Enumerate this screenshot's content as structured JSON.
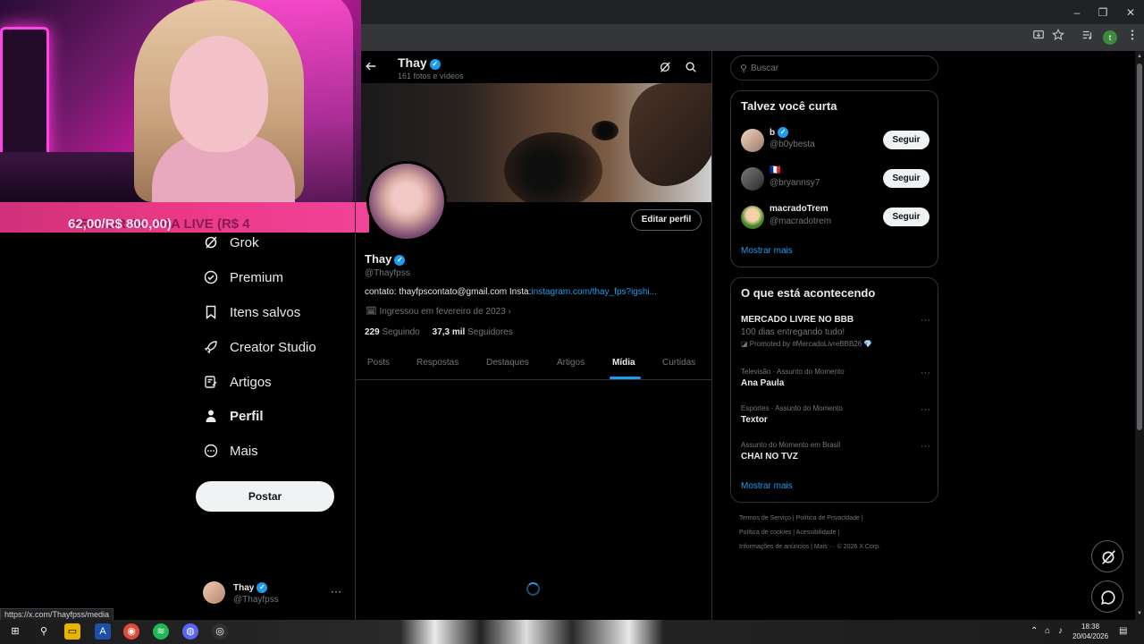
{
  "stream_overlay": {
    "banner_text_dim": "MELHORIAS PRA LIVE (R$ 4",
    "banner_text_bright": "62,00/R$ 800,00)"
  },
  "window_controls": [
    "–",
    "❐",
    "✕"
  ],
  "nav": {
    "items": [
      {
        "label": "Grok",
        "icon": "grok-icon"
      },
      {
        "label": "Premium",
        "icon": "premium-icon"
      },
      {
        "label": "Itens salvos",
        "icon": "bookmark-icon"
      },
      {
        "label": "Creator Studio",
        "icon": "rocket-icon"
      },
      {
        "label": "Artigos",
        "icon": "article-icon"
      },
      {
        "label": "Perfil",
        "icon": "person-icon",
        "active": true
      },
      {
        "label": "Mais",
        "icon": "more-circle-icon"
      }
    ],
    "post_button": "Postar"
  },
  "account": {
    "name": "Thay",
    "handle": "@Thayfpss",
    "more": "···"
  },
  "status_url": "https://x.com/Thayfpss/media",
  "profile_header": {
    "name": "Thay",
    "subtitle": "161 fotos e vídeos"
  },
  "profile": {
    "edit_button": "Editar perfil",
    "name": "Thay",
    "handle": "@Thayfpss",
    "bio_text": "contato: thayfpscontato@gmail.com Insta:",
    "bio_link": "instagram.com/thay_fps?igshi...",
    "joined": "Ingressou em fevereiro de 2023",
    "following_count": "229",
    "following_label": "Seguindo",
    "followers_count": "37,3 mil",
    "followers_label": "Seguidores"
  },
  "tabs": [
    {
      "label": "Posts"
    },
    {
      "label": "Respostas"
    },
    {
      "label": "Destaques"
    },
    {
      "label": "Artigos"
    },
    {
      "label": "Mídia",
      "active": true
    },
    {
      "label": "Curtidas"
    }
  ],
  "search": {
    "placeholder": "Buscar"
  },
  "suggestions": {
    "title": "Talvez você curta",
    "items": [
      {
        "name": "b",
        "handle": "@b0ybesta",
        "verified": true,
        "button": "Seguir"
      },
      {
        "name": "🇫🇷",
        "handle": "@bryannsy7",
        "verified": false,
        "button": "Seguir"
      },
      {
        "name": "macradoTrem",
        "handle": "@macradotrem",
        "verified": false,
        "button": "Seguir"
      }
    ],
    "show_more": "Mostrar mais"
  },
  "trends": {
    "title": "O que está acontecendo",
    "items": [
      {
        "context": "",
        "title": "MERCADO LIVRE NO BBB",
        "subtitle": "100 dias entregando tudo!",
        "promo": "Promoted by #MercadoLivreBBB26 💎"
      },
      {
        "context": "Televisão · Assunto do Momento",
        "title": "Ana Paula"
      },
      {
        "context": "Esportes · Assunto do Momento",
        "title": "Textor"
      },
      {
        "context": "Assunto do Momento em Brasil",
        "title": "CHAI NO TVZ"
      }
    ],
    "show_more": "Mostrar mais"
  },
  "footer": {
    "line1": "Termos de Serviço  |  Política de Privacidade  |",
    "line2": "Política de cookies  |  Acessibilidade  |",
    "line3": "Informações de anúncios  |  Mais ···  © 2026 X Corp."
  },
  "taskbar": {
    "time": "18:38",
    "date": "20/04/2026"
  },
  "colors": {
    "accent": "#1d9bf0",
    "background": "#000000",
    "border": "#2f3336",
    "muted": "#71767b"
  }
}
